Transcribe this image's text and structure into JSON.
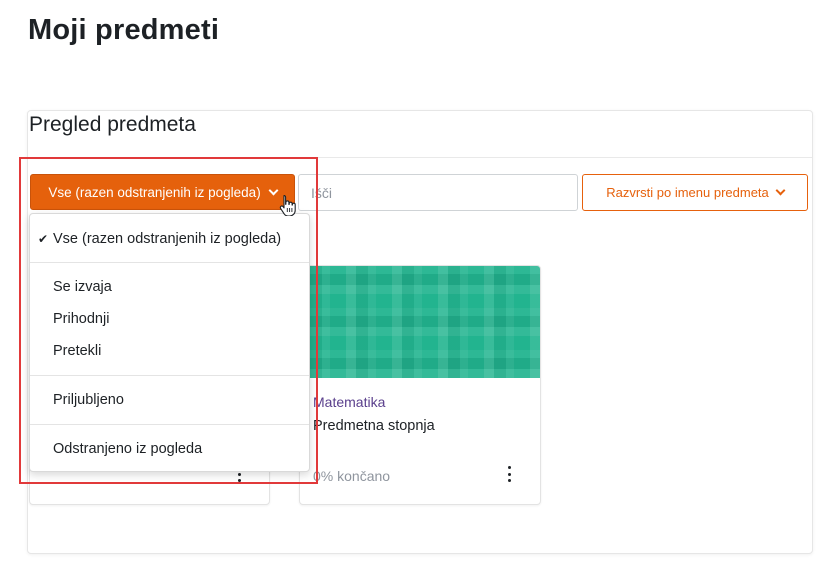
{
  "page": {
    "title": "Moji predmeti"
  },
  "block": {
    "title": "Pregled predmeta"
  },
  "filter": {
    "label": "Vse (razen odstranjenih iz pogleda)"
  },
  "search": {
    "placeholder": "Išči"
  },
  "sort": {
    "label": "Razvrsti po imenu predmeta"
  },
  "dropdown": {
    "items": [
      {
        "label": "Vse (razen odstranjenih iz pogleda)",
        "checked": true
      },
      {
        "label": "Se izvaja"
      },
      {
        "label": "Prihodnji"
      },
      {
        "label": "Pretekli"
      },
      {
        "label": "Priljubljeno"
      },
      {
        "label": "Odstranjeno iz pogleda"
      }
    ]
  },
  "courses": [
    {
      "category": "Matematika",
      "name": "Predmetna stopnja",
      "progress": "0% končano",
      "progress_value": 0
    }
  ],
  "colors": {
    "accent": "#e5610c",
    "highlight": "#e1393a",
    "course_image": "#22b48f",
    "category_link": "#5a3f8c"
  },
  "icons": {
    "checked": "check-icon",
    "dropdown": "chevron-down-icon",
    "more": "kebab-menu-icon",
    "pointer": "hand-cursor-icon"
  }
}
